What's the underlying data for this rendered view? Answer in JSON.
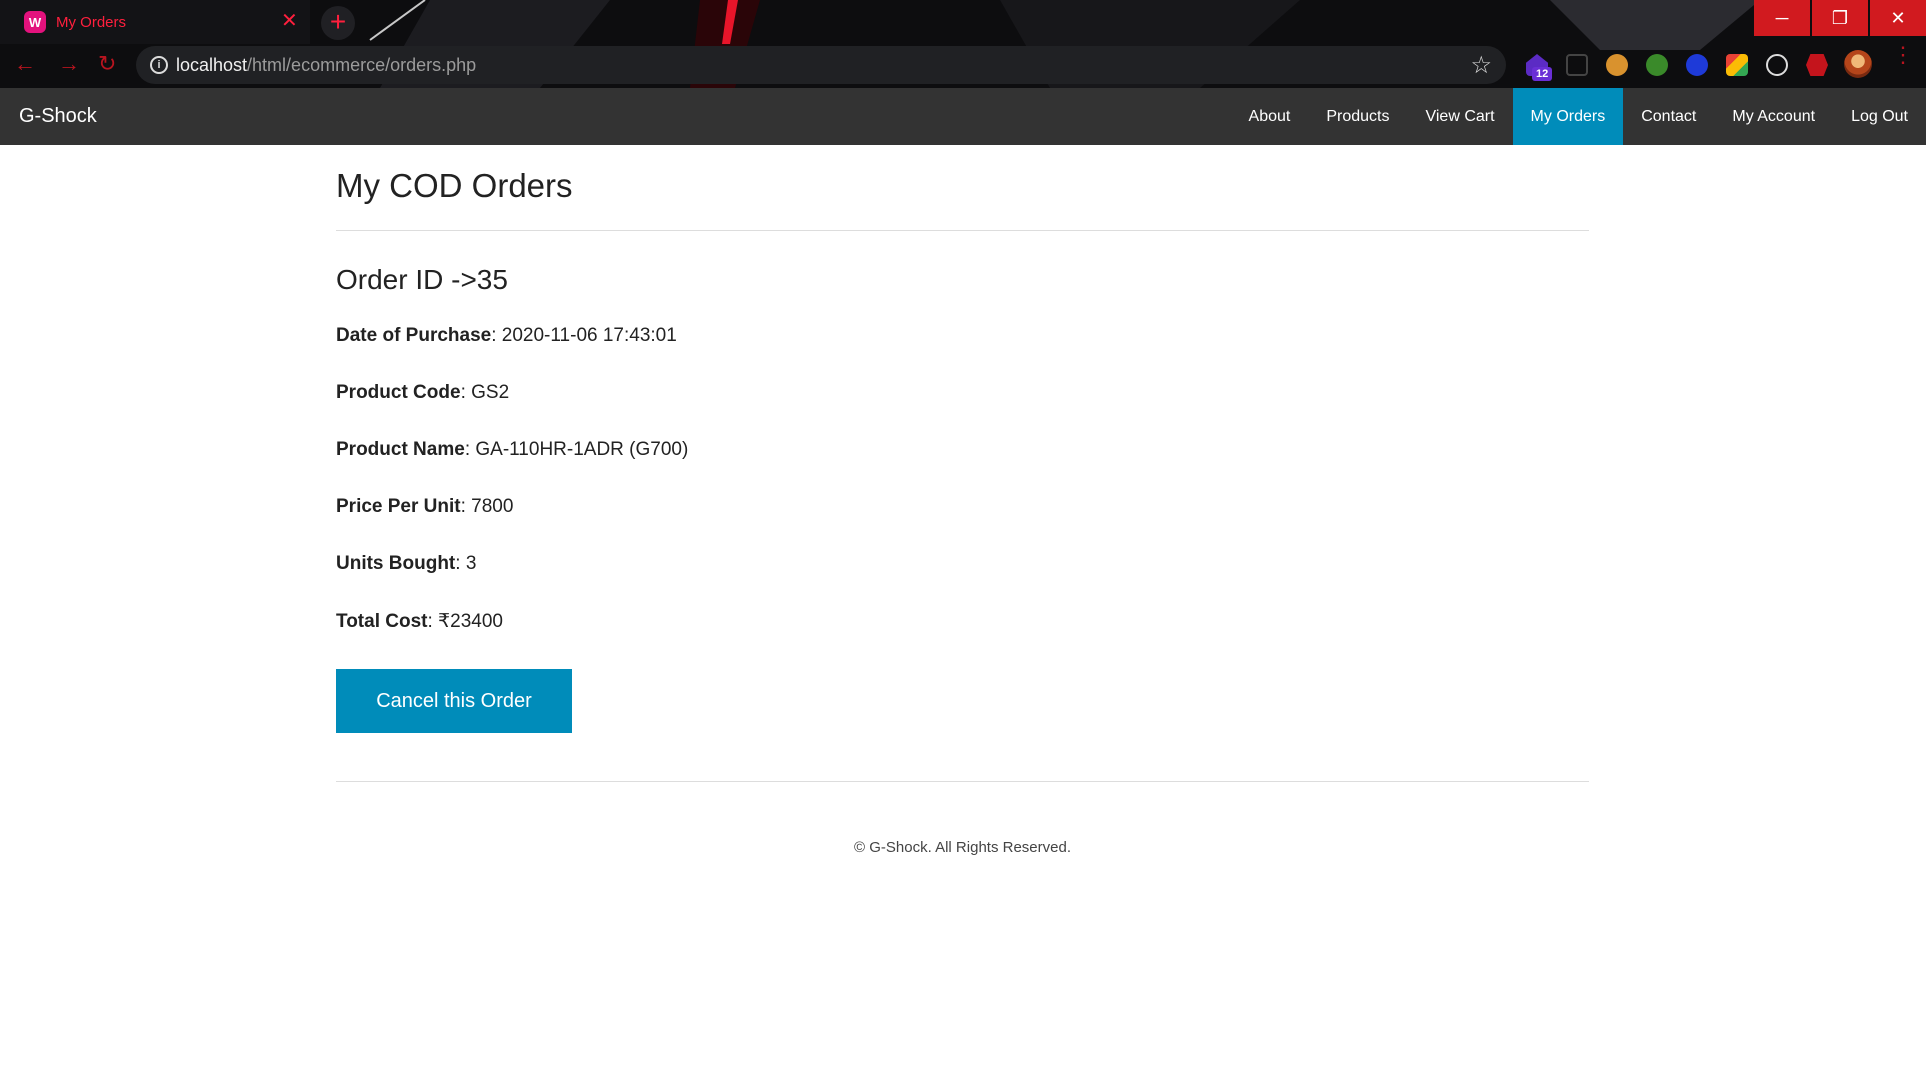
{
  "browser": {
    "tab_title": "My Orders",
    "tab_close": "✕",
    "new_tab": "+",
    "url_host": "localhost",
    "url_path": "/html/ecommerce/orders.php",
    "extension_badge": "12",
    "window_controls": {
      "minimize": "─",
      "restore": "❐",
      "close": "✕"
    },
    "accent_color": "#ff1f3d"
  },
  "navbar": {
    "brand": "G-Shock",
    "links": [
      {
        "label": "About"
      },
      {
        "label": "Products"
      },
      {
        "label": "View Cart"
      },
      {
        "label": "My Orders",
        "active": true
      },
      {
        "label": "Contact"
      },
      {
        "label": "My Account"
      },
      {
        "label": "Log Out"
      }
    ],
    "background_color": "#333333",
    "active_color": "#008cba"
  },
  "main": {
    "title": "My COD Orders",
    "order": {
      "heading": "Order ID ->35",
      "fields": [
        {
          "label": "Date of Purchase",
          "value": ": 2020-11-06 17:43:01"
        },
        {
          "label": "Product Code",
          "value": ": GS2"
        },
        {
          "label": "Product Name",
          "value": ": GA-110HR-1ADR (G700)"
        },
        {
          "label": "Price Per Unit",
          "value": ": 7800"
        },
        {
          "label": "Units Bought",
          "value": ": 3"
        },
        {
          "label": "Total Cost",
          "value": ": ₹23400"
        }
      ],
      "cancel_label": "Cancel this Order"
    }
  },
  "footer": {
    "copyright": "© G-Shock. All Rights Reserved."
  }
}
